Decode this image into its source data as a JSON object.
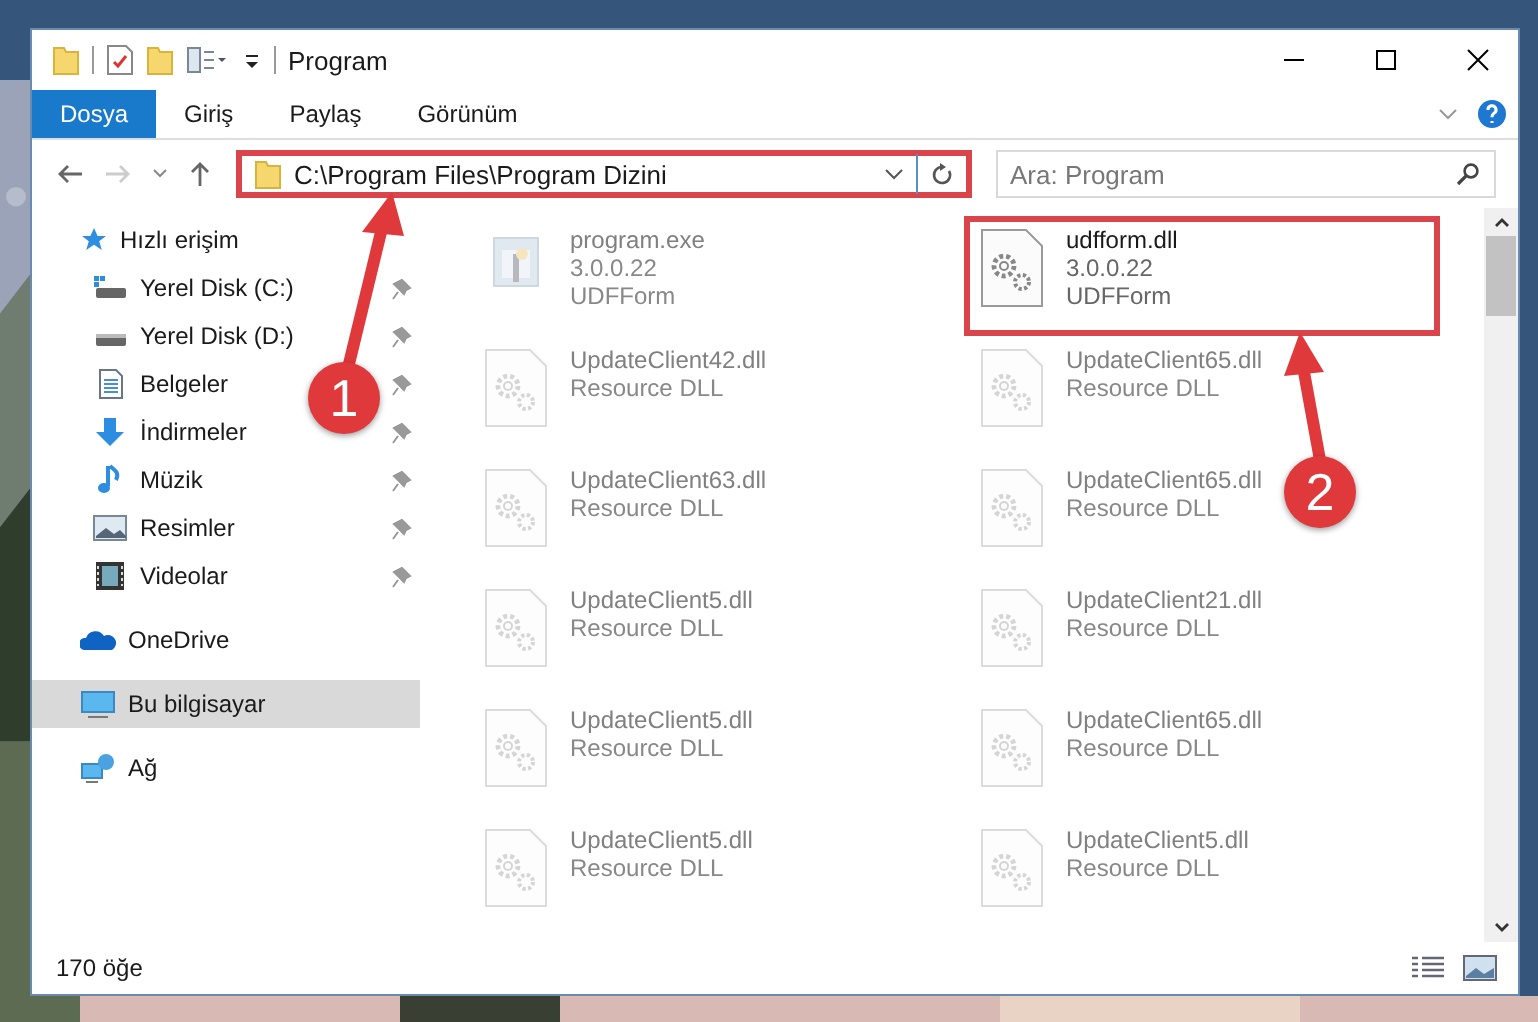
{
  "window": {
    "title": "Program"
  },
  "ribbon_tabs": [
    {
      "label": "Dosya",
      "selected": true
    },
    {
      "label": "Giriş",
      "selected": false
    },
    {
      "label": "Paylaş",
      "selected": false
    },
    {
      "label": "Görünüm",
      "selected": false
    }
  ],
  "address": {
    "path": "C:\\Program Files\\Program Dizini",
    "highlighted": true
  },
  "search": {
    "placeholder": "Ara: Program"
  },
  "sidebar": {
    "items": [
      {
        "label": "Hızlı erişim",
        "kind": "star",
        "selected": false,
        "children": [
          {
            "label": "Yerel Disk (C:)",
            "kind": "system-drive",
            "pinned": true,
            "selected": false
          },
          {
            "label": "Yerel Disk (D:)",
            "kind": "drive",
            "pinned": true,
            "selected": false
          },
          {
            "label": "Belgeler",
            "kind": "document",
            "pinned": true,
            "selected": false
          },
          {
            "label": "İndirmeler",
            "kind": "download",
            "pinned": true,
            "selected": false
          },
          {
            "label": "Müzik",
            "kind": "music",
            "pinned": true,
            "selected": false
          },
          {
            "label": "Resimler",
            "kind": "pictures",
            "pinned": true,
            "selected": false
          },
          {
            "label": "Videolar",
            "kind": "video",
            "pinned": true,
            "selected": false
          }
        ]
      },
      {
        "label": "OneDrive",
        "kind": "cloud",
        "selected": false
      },
      {
        "label": "Bu bilgisayar",
        "kind": "computer",
        "selected": true
      },
      {
        "label": "Ağ",
        "kind": "network",
        "selected": false
      }
    ]
  },
  "files": [
    {
      "name": "program.exe",
      "lines": [
        "3.0.0.22",
        "UDFForm"
      ],
      "kind": "exe",
      "faded": true,
      "highlighted": false
    },
    {
      "name": "udfform.dll",
      "lines": [
        "3.0.0.22",
        "UDFForm"
      ],
      "kind": "dll",
      "faded": false,
      "highlighted": true
    },
    {
      "name": "UpdateClient42.dll",
      "lines": [
        "Resource DLL"
      ],
      "kind": "dll",
      "faded": true,
      "highlighted": false
    },
    {
      "name": "UpdateClient65.dll",
      "lines": [
        "Resource DLL"
      ],
      "kind": "dll",
      "faded": true,
      "highlighted": false
    },
    {
      "name": "UpdateClient63.dll",
      "lines": [
        "Resource DLL"
      ],
      "kind": "dll",
      "faded": true,
      "highlighted": false
    },
    {
      "name": "UpdateClient65.dll",
      "lines": [
        "Resource DLL"
      ],
      "kind": "dll",
      "faded": true,
      "highlighted": false
    },
    {
      "name": "UpdateClient5.dll",
      "lines": [
        "Resource DLL"
      ],
      "kind": "dll",
      "faded": true,
      "highlighted": false
    },
    {
      "name": "UpdateClient21.dll",
      "lines": [
        "Resource DLL"
      ],
      "kind": "dll",
      "faded": true,
      "highlighted": false
    },
    {
      "name": "UpdateClient5.dll",
      "lines": [
        "Resource DLL"
      ],
      "kind": "dll",
      "faded": true,
      "highlighted": false
    },
    {
      "name": "UpdateClient65.dll",
      "lines": [
        "Resource DLL"
      ],
      "kind": "dll",
      "faded": true,
      "highlighted": false
    },
    {
      "name": "UpdateClient5.dll",
      "lines": [
        "Resource DLL"
      ],
      "kind": "dll",
      "faded": true,
      "highlighted": false
    },
    {
      "name": "UpdateClient5.dll",
      "lines": [
        "Resource DLL"
      ],
      "kind": "dll",
      "faded": true,
      "highlighted": false
    }
  ],
  "status_bar": {
    "count": "170 öğe"
  },
  "annotations": [
    {
      "label": "1"
    },
    {
      "label": "2"
    }
  ]
}
